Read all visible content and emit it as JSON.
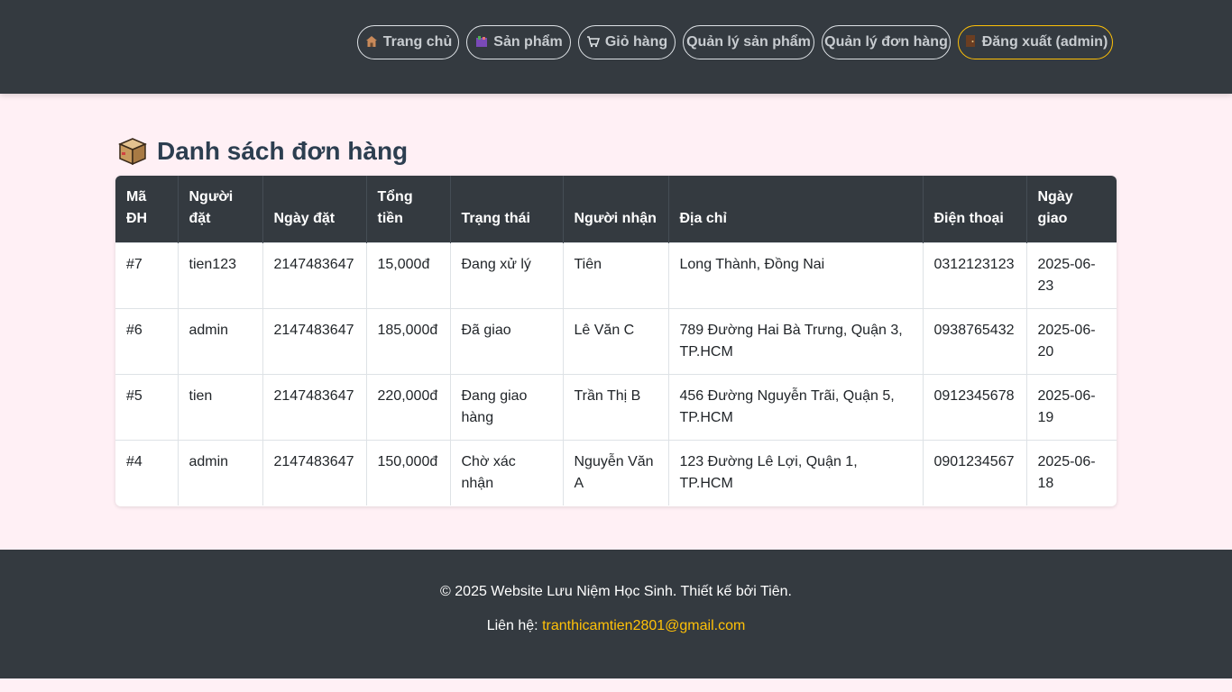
{
  "nav": {
    "home": {
      "icon": "house-icon",
      "label": "Trang chủ"
    },
    "products": {
      "icon": "products-icon",
      "label": "Sản phẩm"
    },
    "cart": {
      "icon": "cart-icon",
      "label": "Giỏ hàng"
    },
    "manage_products": {
      "label": "Quản lý sản phẩm"
    },
    "manage_orders": {
      "label": "Quản lý đơn hàng"
    },
    "logout": {
      "icon": "door-icon",
      "label": "Đăng xuất (admin)"
    }
  },
  "page": {
    "title_icon": "package-box-icon",
    "title": "Danh sách đơn hàng"
  },
  "orders_table": {
    "headers": [
      "Mã ĐH",
      "Người đặt",
      "Ngày đặt",
      "Tổng tiền",
      "Trạng thái",
      "Người nhận",
      "Địa chỉ",
      "Điện thoại",
      "Ngày giao"
    ],
    "rows": [
      [
        "#7",
        "tien123",
        "2147483647",
        "15,000đ",
        "Đang xử lý",
        "Tiên",
        "Long Thành, Đồng Nai",
        "0312123123",
        "2025-06-23"
      ],
      [
        "#6",
        "admin",
        "2147483647",
        "185,000đ",
        "Đã giao",
        "Lê Văn C",
        "789 Đường Hai Bà Trưng, Quận 3, TP.HCM",
        "0938765432",
        "2025-06-20"
      ],
      [
        "#5",
        "tien",
        "2147483647",
        "220,000đ",
        "Đang giao hàng",
        "Trần Thị B",
        "456 Đường Nguyễn Trãi, Quận 5, TP.HCM",
        "0912345678",
        "2025-06-19"
      ],
      [
        "#4",
        "admin",
        "2147483647",
        "150,000đ",
        "Chờ xác nhận",
        "Nguyễn Văn A",
        "123 Đường Lê Lợi, Quận 1, TP.HCM",
        "0901234567",
        "2025-06-18"
      ]
    ]
  },
  "footer": {
    "copyright": "© 2025 Website Lưu Niệm Học Sinh. Thiết kế bởi Tiên.",
    "contact_label": "Liên hệ: ",
    "contact_email": "tranthicamtien2801@gmail.com"
  },
  "colors": {
    "navbar_bg": "#343a40",
    "page_bg": "#fff0f5",
    "accent": "#ffc107",
    "title": "#2c3e50"
  }
}
